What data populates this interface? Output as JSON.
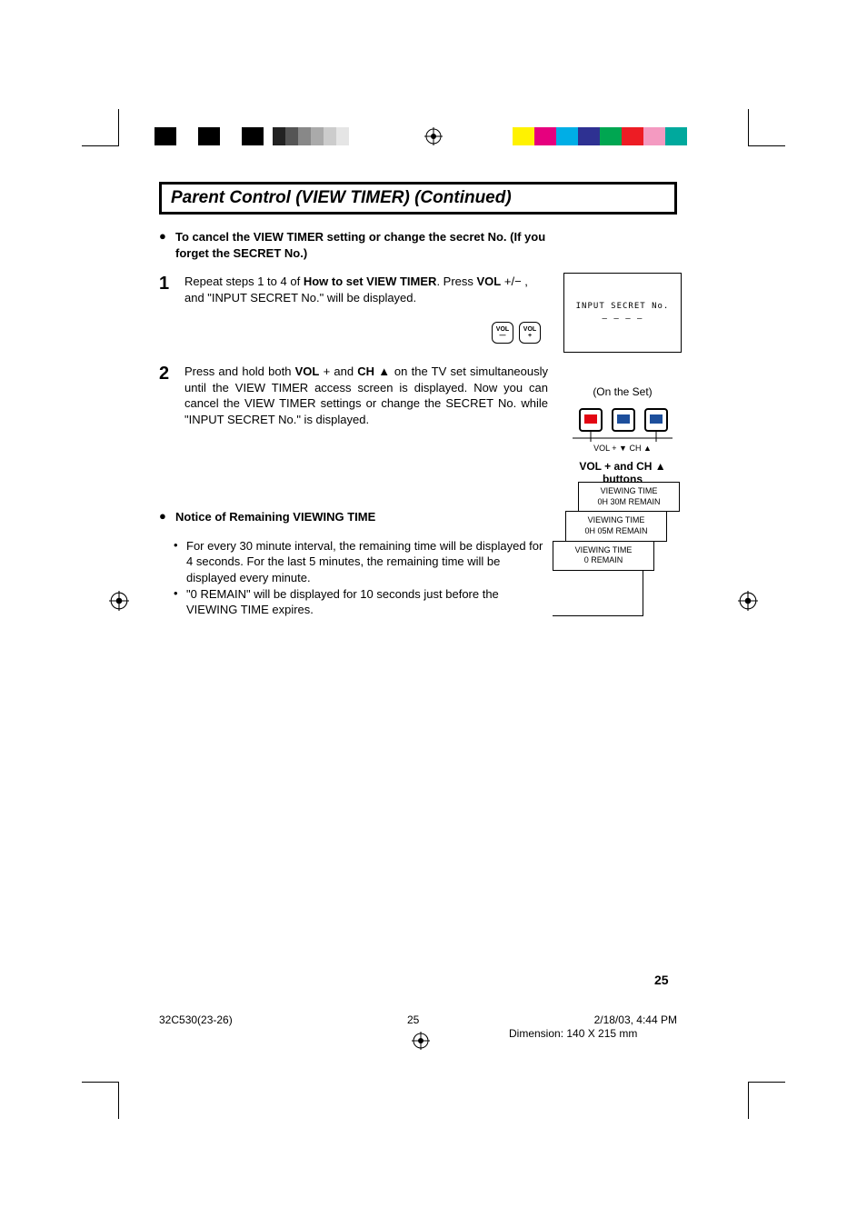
{
  "header": "Parent Control (VIEW TIMER) (Continued)",
  "intro": {
    "bullet_text": "To cancel the VIEW TIMER setting or change the secret No. (If you forget the SECRET No.)"
  },
  "step1": {
    "num": "1",
    "text_a": "Repeat steps 1 to 4 of ",
    "text_b_bold": "How to set VIEW TIMER",
    "text_c": ". Press ",
    "text_d_bold": "VOL",
    "text_e": " +/− , and \"INPUT SECRET No.\" will be displayed."
  },
  "step2": {
    "num": "2",
    "text_a": "Press and hold both ",
    "text_b_bold": "VOL",
    "text_c": " + and ",
    "text_d_bold": "CH",
    "text_e": " ▲ on the TV set simultaneously until the VIEW TIMER access screen is displayed. Now you can cancel the VIEW TIMER settings or change the SECRET No. while \"INPUT SECRET No.\" is displayed."
  },
  "notice": {
    "title": "Notice of Remaining VIEWING TIME",
    "item1": "For every 30 minute interval, the remaining time will be displayed for 4 seconds. For the last 5 minutes, the remaining time will be displayed every minute.",
    "item2": "\"0 REMAIN\" will be displayed for 10 seconds just before the VIEWING TIME expires."
  },
  "screen": {
    "line1": "INPUT SECRET No.",
    "line2": "– – – –"
  },
  "vol_buttons": {
    "minus_top": "VOL",
    "minus_bot": "—",
    "plus_top": "VOL",
    "plus_bot": "+"
  },
  "onset_label": "(On the Set)",
  "tv_button_labels": "VOL  +        ▼   CH   ▲",
  "vol_ch_caption_a": "VOL + and CH ▲",
  "vol_ch_caption_b": "buttons",
  "remain": {
    "b1_l1": "VIEWING TIME",
    "b1_l2": "0H  30M  REMAIN",
    "b2_l1": "VIEWING TIME",
    "b2_l2": "0H  05M  REMAIN",
    "b3_l1": "VIEWING TIME",
    "b3_l2": "0  REMAIN"
  },
  "page_num": "25",
  "footer": {
    "file": "32C530(23-26)",
    "pg": "25",
    "date": "2/18/03, 4:44 PM",
    "dim": "Dimension: 140  X 215 mm"
  },
  "colors": {
    "cyan": "#00aee6",
    "magenta": "#e6007e",
    "yellow": "#fff200",
    "green": "#00a651",
    "blue": "#2e3192",
    "red": "#ed1c24",
    "pink": "#f49ac1",
    "teal": "#00a99d"
  }
}
